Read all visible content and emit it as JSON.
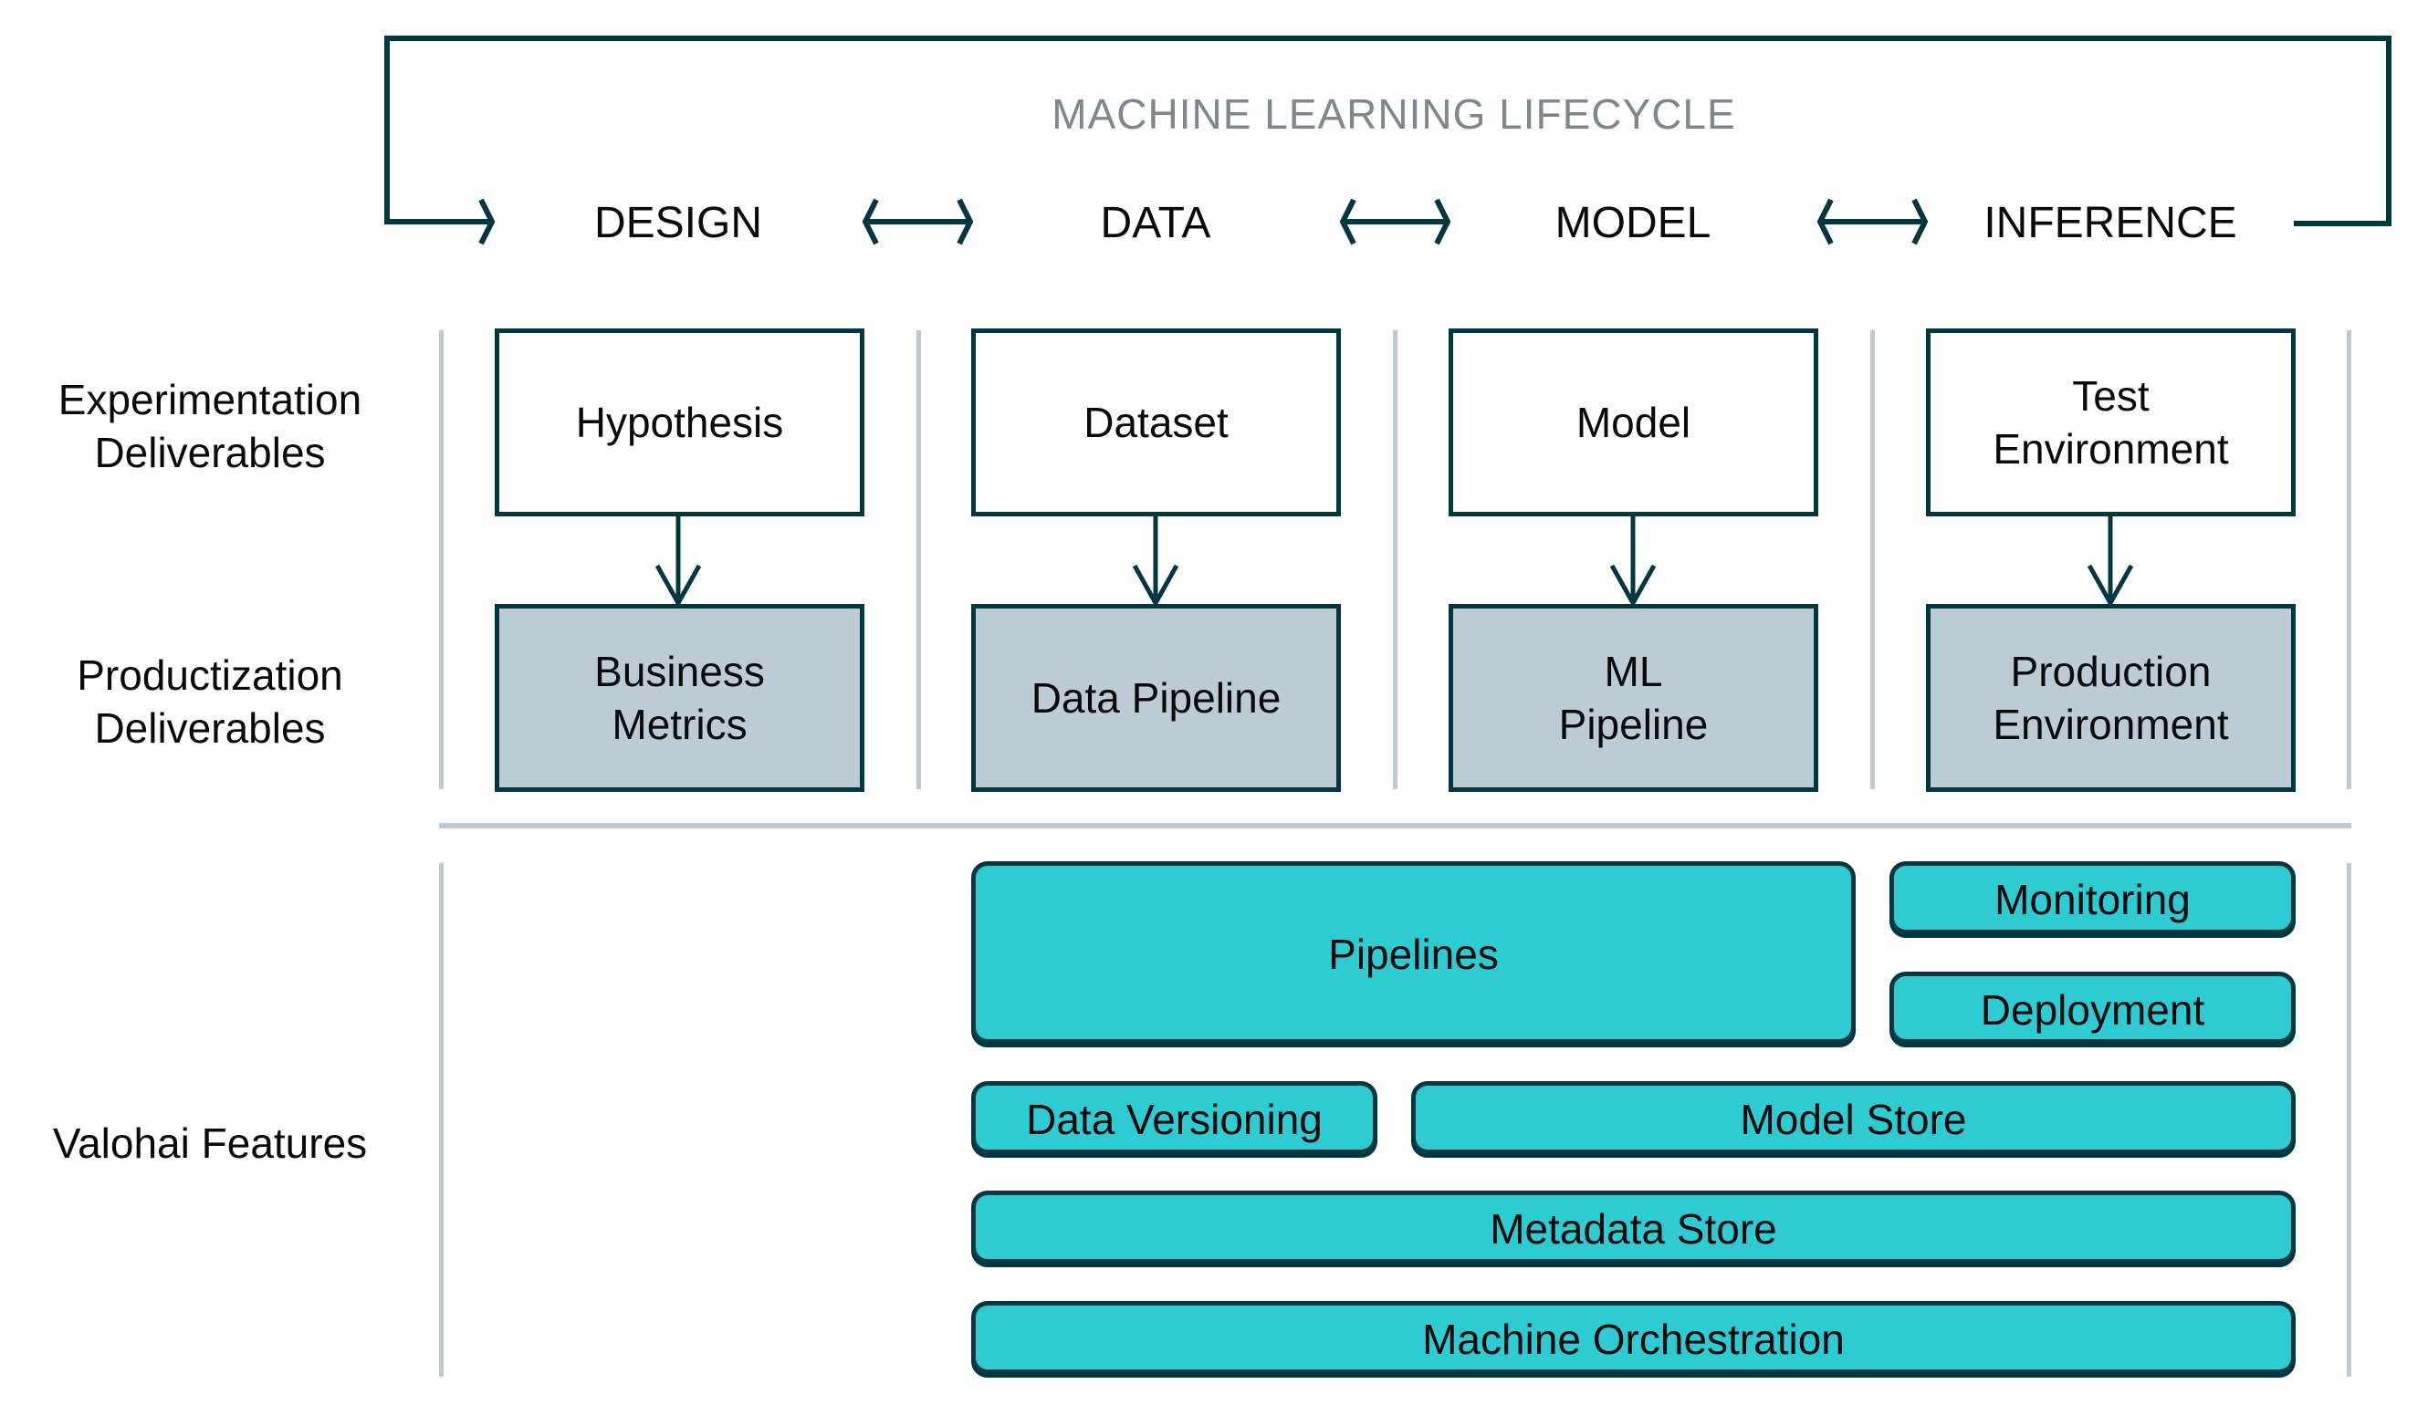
{
  "title": "MACHINE LEARNING LIFECYCLE",
  "stages": [
    "DESIGN",
    "DATA",
    "MODEL",
    "INFERENCE"
  ],
  "row_labels": {
    "experimentation": "Experimentation Deliverables",
    "experimentation_lines": [
      "Experimentation",
      "Deliverables"
    ],
    "productization_lines": [
      "Productization",
      "Deliverables"
    ],
    "features": "Valohai Features"
  },
  "experimentation_deliverables": [
    {
      "lines": [
        "Hypothesis"
      ]
    },
    {
      "lines": [
        "Dataset"
      ]
    },
    {
      "lines": [
        "Model"
      ]
    },
    {
      "lines": [
        "Test",
        "Environment"
      ]
    }
  ],
  "productization_deliverables": [
    {
      "lines": [
        "Business",
        "Metrics"
      ]
    },
    {
      "lines": [
        "Data Pipeline"
      ]
    },
    {
      "lines": [
        "ML",
        "Pipeline"
      ]
    },
    {
      "lines": [
        "Production",
        "Environment"
      ]
    }
  ],
  "features": {
    "pipelines": "Pipelines",
    "monitoring": "Monitoring",
    "deployment": "Deployment",
    "data_versioning": "Data Versioning",
    "model_store": "Model Store",
    "metadata_store": "Metadata Store",
    "machine_orchestration": "Machine Orchestration"
  },
  "colors": {
    "frame": "#033740",
    "title_gray": "#7e878c",
    "production_fill": "#bdcbd4",
    "feature_teal": "#2ecbd2",
    "divider": "#bdcad3"
  }
}
